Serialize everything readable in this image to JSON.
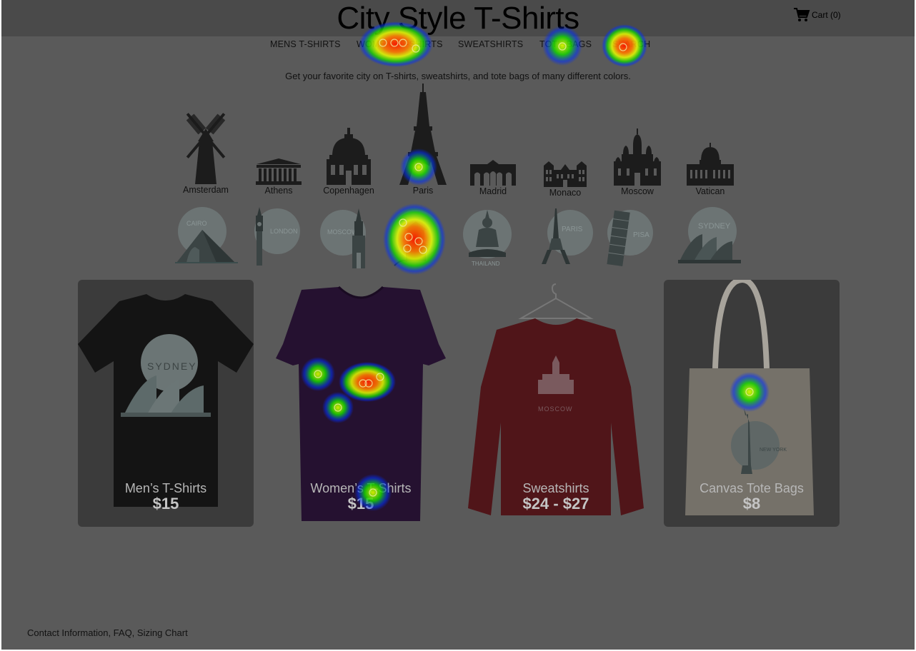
{
  "header": {
    "title": "City Style T-Shirts",
    "cart_label": "Cart (0)"
  },
  "nav": {
    "items": [
      {
        "label": "MENS T-SHIRTS"
      },
      {
        "label": "WOMENS T-SHIRTS"
      },
      {
        "label": "SWEATSHIRTS"
      },
      {
        "label": "TOTE BAGS"
      },
      {
        "label": "SEARCH"
      }
    ]
  },
  "tagline": "Get your favorite city on T-shirts, sweatshirts, and tote bags of many different colors.",
  "cities": [
    {
      "name": "Amsterdam",
      "icon": "windmill-icon"
    },
    {
      "name": "Athens",
      "icon": "parthenon-icon"
    },
    {
      "name": "Copenhagen",
      "icon": "domed-church-icon"
    },
    {
      "name": "Paris",
      "icon": "eiffel-tower-icon"
    },
    {
      "name": "Madrid",
      "icon": "arch-gate-icon"
    },
    {
      "name": "Monaco",
      "icon": "palace-icon"
    },
    {
      "name": "Moscow",
      "icon": "kremlin-icon"
    },
    {
      "name": "Vatican",
      "icon": "basilica-icon"
    }
  ],
  "stamps": [
    {
      "label": "CAIRO",
      "icon": "pyramid-sphinx-icon"
    },
    {
      "label": "LONDON",
      "icon": "big-ben-icon"
    },
    {
      "label": "MOSCOW",
      "icon": "kremlin-tower-icon"
    },
    {
      "label": "",
      "icon": "pagoda-icon"
    },
    {
      "label": "THAILAND",
      "icon": "buddha-icon"
    },
    {
      "label": "PARIS",
      "icon": "eiffel-tower-icon"
    },
    {
      "label": "PISA",
      "icon": "leaning-tower-icon"
    },
    {
      "label": "SYDNEY",
      "icon": "opera-house-icon"
    }
  ],
  "products": [
    {
      "name": "Men’s T-Shirts",
      "price": "$15",
      "print": "SYDNEY",
      "color": "#141414"
    },
    {
      "name": "Women’s T-Shirts",
      "price": "$15",
      "print": "",
      "color": "#251130"
    },
    {
      "name": "Sweatshirts",
      "price": "$24 - $27",
      "print": "MOSCOW",
      "color": "#501519"
    },
    {
      "name": "Canvas Tote Bags",
      "price": "$8",
      "print": "NEW YORK",
      "color": "#cfcac1"
    }
  ],
  "footer": {
    "links": "Contact Information, FAQ, Sizing Chart"
  }
}
